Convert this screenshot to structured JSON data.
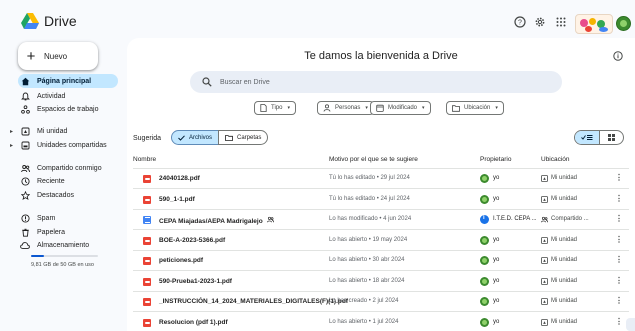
{
  "app": {
    "name": "Drive"
  },
  "topbar": {
    "icons": [
      "help-icon",
      "settings-icon",
      "apps-grid-icon"
    ]
  },
  "sidebar": {
    "new_label": "Nuevo",
    "items": [
      {
        "label": "Página principal",
        "icon": "home-icon",
        "active": true
      },
      {
        "label": "Actividad",
        "icon": "bell-icon"
      },
      {
        "label": "Espacios de trabajo",
        "icon": "workspaces-icon"
      },
      {
        "label": "Mi unidad",
        "icon": "my-drive-icon",
        "caret": true
      },
      {
        "label": "Unidades compartidas",
        "icon": "shared-drives-icon",
        "caret": true
      },
      {
        "label": "Compartido conmigo",
        "icon": "people-icon"
      },
      {
        "label": "Reciente",
        "icon": "clock-icon"
      },
      {
        "label": "Destacados",
        "icon": "star-icon"
      },
      {
        "label": "Spam",
        "icon": "spam-icon"
      },
      {
        "label": "Papelera",
        "icon": "trash-icon"
      },
      {
        "label": "Almacenamiento",
        "icon": "cloud-icon"
      }
    ],
    "storage_text": "9,81 GB de 50 GB en uso",
    "storage_fraction": 0.196
  },
  "main": {
    "welcome": "Te damos la bienvenida a Drive",
    "search_placeholder": "Buscar en Drive",
    "filters": [
      {
        "label": "Tipo",
        "icon": "file-icon"
      },
      {
        "label": "Personas",
        "icon": "person-icon"
      },
      {
        "label": "Modificado",
        "icon": "calendar-icon"
      },
      {
        "label": "Ubicación",
        "icon": "folder-icon"
      }
    ],
    "suggested_label": "Sugerida",
    "toggle": {
      "files": "Archivos",
      "folders": "Carpetas"
    },
    "columns": {
      "name": "Nombre",
      "reason": "Motivo por el que se te sugiere",
      "owner": "Propietario",
      "location": "Ubicación"
    },
    "rows": [
      {
        "name": "24040128.pdf",
        "type": "pdf",
        "reason": "Tú lo has editado • 29 jul 2024",
        "owner": "yo",
        "owner_avatar": "green",
        "location": "Mi unidad",
        "loc_icon": "drive-icon"
      },
      {
        "name": "590_1-1.pdf",
        "type": "pdf",
        "reason": "Tú lo has editado • 24 jul 2024",
        "owner": "yo",
        "owner_avatar": "green",
        "location": "Mi unidad",
        "loc_icon": "drive-icon"
      },
      {
        "name": "CEPA Miajadas/AEPA Madrigalejo",
        "type": "doc",
        "shared": true,
        "reason": "Lo has modificado • 4 jun 2024",
        "owner": "I.T.E.D. CEPA ...",
        "owner_avatar": "info",
        "location": "Compartido ...",
        "loc_icon": "people-icon"
      },
      {
        "name": "BOE-A-2023-5366.pdf",
        "type": "pdf",
        "reason": "Lo has abierto • 19 may 2024",
        "owner": "yo",
        "owner_avatar": "green",
        "location": "Mi unidad",
        "loc_icon": "drive-icon"
      },
      {
        "name": "peticiones.pdf",
        "type": "pdf",
        "reason": "Lo has abierto • 30 abr 2024",
        "owner": "yo",
        "owner_avatar": "green",
        "location": "Mi unidad",
        "loc_icon": "drive-icon"
      },
      {
        "name": "590-Prueba1-2023-1.pdf",
        "type": "pdf",
        "reason": "Lo has abierto • 18 abr 2024",
        "owner": "yo",
        "owner_avatar": "green",
        "location": "Mi unidad",
        "loc_icon": "drive-icon"
      },
      {
        "name": "_INSTRUCCIÓN_14_2024_MATERIALES_DIGITALES(F)(1).pdf",
        "type": "pdf",
        "reason": "Lo has creado • 2 jul 2024",
        "owner": "yo",
        "owner_avatar": "green",
        "location": "Mi unidad",
        "loc_icon": "drive-icon"
      },
      {
        "name": "Resolucion (pdf 1).pdf",
        "type": "pdf",
        "reason": "Lo has abierto • 1 jul 2024",
        "owner": "yo",
        "owner_avatar": "green",
        "location": "Mi unidad",
        "loc_icon": "drive-icon"
      }
    ]
  },
  "colors": {
    "accent": "#0b57d0",
    "selected": "#c2e7ff",
    "background": "#f8fafd",
    "pdf": "#ea4335",
    "doc": "#4285f4"
  }
}
